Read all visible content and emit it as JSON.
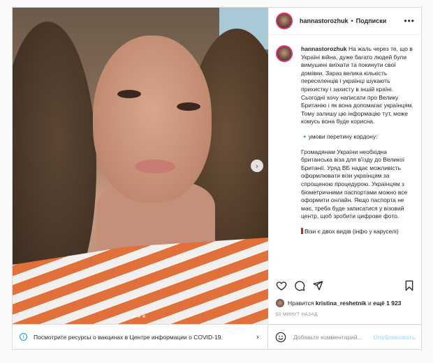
{
  "post": {
    "username": "hannastorozhuk",
    "separator": "•",
    "follow_label": "Подписки",
    "more_icon": "more-horizontal-icon",
    "caption": {
      "username": "hannastorozhuk",
      "p1": "На жаль через те, що в Україні війна, дуже багато людей були вимушені виїхати та покинути свої домівки. Зараз велика кількість переселенців і українці шукають прихистку і захисту в іншій країні. Сьогодні хочу написати про Велику Британію і як вона допомагає українцям. Тому залишу цю інформацію тут, може комусь вона буде корисна.",
      "p2_marker": "🔹",
      "p2": "умови перетину кордону:",
      "p3": "Громадянам України необхідна британська віза для в'їзду до Великої Британії. Уряд ВБ надає можливість оформлювати візи українцям за спрощеною процедурою. Українцям з біометричними паспортами можно все оформити онлайн. Якщо паспорта не має, треба буде записатися у візовий центр, щоб зробити цифрове фото.",
      "p4": "Візи є двох видів (інфо у каруселі)"
    },
    "likes": {
      "prefix": "Нравится",
      "user": "kristina_reshetnik",
      "and": "и",
      "more": "ещё 1 923"
    },
    "time": "50 МИНУТ НАЗАД",
    "comment_placeholder": "Добавьте комментарий...",
    "publish_label": "Опубликовать",
    "carousel": {
      "slides": 3,
      "active": 1
    }
  },
  "covid_banner": {
    "text": "Посмотрите ресурсы о вакцинах в Центре информации о COVID-19.",
    "icon": "info-icon"
  },
  "colors": {
    "accent_link": "#0095f6",
    "publish_disabled": "#b2dffc",
    "story_ring": "#e1306c"
  }
}
